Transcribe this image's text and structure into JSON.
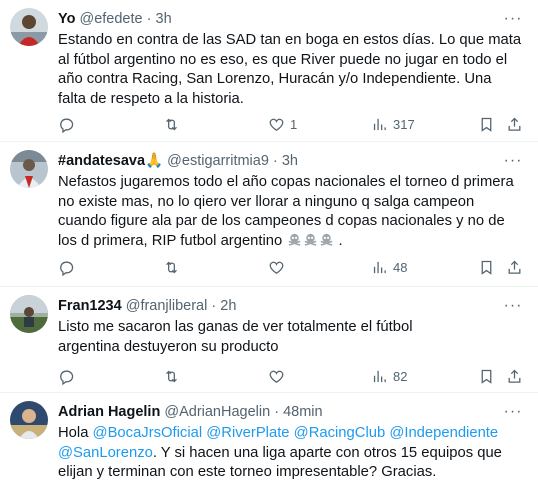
{
  "tweets": [
    {
      "name": "Yo",
      "handle": "@efedete",
      "dot": "·",
      "time": "3h",
      "more": "···",
      "text": "Estando en contra de las SAD tan en boga en estos días. Lo que mata al fútbol argentino no es eso, es que River puede no jugar en todo el año contra Racing, San Lorenzo, Huracán y/o Independiente. Una falta de respeto a la historia.",
      "replies": "",
      "retweets": "",
      "likes": "1",
      "views": "317"
    },
    {
      "name": "#andatesava",
      "name_emoji": "🙏",
      "handle": "@estigarritmia9",
      "dot": "·",
      "time": "3h",
      "more": "···",
      "text": "Nefastos jugaremos todo el año copas nacionales el torneo d primera no existe mas, no lo qiero ver llorar a ninguno q salga campeon cuando figure ala par de los campeones d copas nacionales  y no de los d primera, RIP futbol argentino",
      "text_tail": " .",
      "replies": "",
      "retweets": "",
      "likes": "",
      "views": "48"
    },
    {
      "name": "Fran1234",
      "handle": "@franjliberal",
      "dot": "·",
      "time": "2h",
      "more": "···",
      "text": "Listo me sacaron las ganas de ver totalmente el fútbol argentina destuyeron su producto",
      "replies": "",
      "retweets": "",
      "likes": "",
      "views": "82"
    },
    {
      "name": "Adrian Hagelin",
      "handle": "@AdrianHagelin",
      "dot": "·",
      "time": "48min",
      "more": "···",
      "text_prefix": "Hola ",
      "mentions": [
        "@BocaJrsOficial",
        "@RiverPlate",
        "@RacingClub",
        "@Independiente",
        "@SanLorenzo"
      ],
      "text_rest": ". Y si hacen una liga aparte con otros 15 equipos que elijan y terminan con este torneo impresentable? Gracias."
    }
  ]
}
